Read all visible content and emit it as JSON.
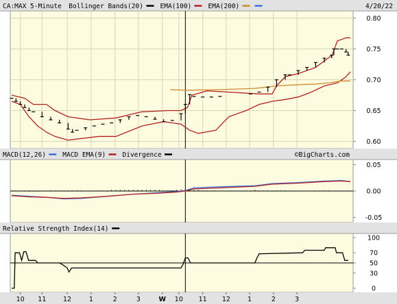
{
  "chart_data": [
    {
      "type": "line",
      "panel": "price",
      "symbol_label": "CA:MAX 5-Minute",
      "date_label": "4/20/22",
      "legend": [
        {
          "label": "Bollinger Bands(20)",
          "color": "#000000"
        },
        {
          "label": "EMA(100)",
          "color": "#b22222"
        },
        {
          "label": "EMA(200)",
          "color": "#d08a2a"
        }
      ],
      "legend_extra_swatch": "#3a6fd8",
      "ylim": [
        0.595,
        0.805
      ],
      "yticks": [
        "0.80",
        "0.75",
        "0.70",
        "0.65",
        "0.60"
      ],
      "grid": true,
      "series": [
        {
          "name": "Bollinger Bands(20)",
          "role": "upper",
          "color": "#b22222",
          "points": [
            [
              0,
              0.675
            ],
            [
              3,
              0.67
            ],
            [
              5,
              0.66
            ],
            [
              8,
              0.66
            ],
            [
              10,
              0.65
            ],
            [
              13,
              0.64
            ],
            [
              18,
              0.635
            ],
            [
              24,
              0.638
            ],
            [
              30,
              0.648
            ],
            [
              36,
              0.65
            ],
            [
              39,
              0.65
            ],
            [
              40.5,
              0.655
            ],
            [
              41.5,
              0.675
            ],
            [
              45,
              0.682
            ],
            [
              50,
              0.68
            ],
            [
              57,
              0.677
            ],
            [
              60,
              0.677
            ],
            [
              61,
              0.69
            ],
            [
              63,
              0.705
            ],
            [
              66,
              0.71
            ],
            [
              70,
              0.72
            ],
            [
              73.8,
              0.74
            ],
            [
              75,
              0.763
            ],
            [
              77,
              0.768
            ],
            [
              78,
              0.768
            ]
          ]
        },
        {
          "name": "Bollinger Bands(20)",
          "role": "lower",
          "color": "#b22222",
          "points": [
            [
              0,
              0.665
            ],
            [
              2,
              0.66
            ],
            [
              4,
              0.64
            ],
            [
              6,
              0.625
            ],
            [
              8,
              0.615
            ],
            [
              10,
              0.608
            ],
            [
              13,
              0.602
            ],
            [
              20,
              0.608
            ],
            [
              24,
              0.608
            ],
            [
              30,
              0.625
            ],
            [
              35,
              0.632
            ],
            [
              39,
              0.628
            ],
            [
              41,
              0.618
            ],
            [
              43,
              0.613
            ],
            [
              47,
              0.618
            ],
            [
              50,
              0.64
            ],
            [
              54,
              0.65
            ],
            [
              57,
              0.66
            ],
            [
              60,
              0.665
            ],
            [
              63,
              0.668
            ],
            [
              66,
              0.672
            ],
            [
              69,
              0.68
            ],
            [
              72,
              0.69
            ],
            [
              75,
              0.695
            ],
            [
              77,
              0.705
            ],
            [
              78,
              0.713
            ]
          ]
        },
        {
          "name": "EMA(200)",
          "color": "#d08a2a",
          "points": [
            [
              36.5,
              0.684
            ],
            [
              40,
              0.683
            ],
            [
              48,
              0.684
            ],
            [
              56,
              0.686
            ],
            [
              61,
              0.69
            ],
            [
              66,
              0.692
            ],
            [
              70,
              0.693
            ],
            [
              73,
              0.695
            ],
            [
              76,
              0.698
            ],
            [
              78,
              0.698
            ]
          ]
        }
      ],
      "ohlc_points": [
        [
          0,
          0.67
        ],
        [
          1,
          0.665
        ],
        [
          2,
          0.66
        ],
        [
          3,
          0.655
        ],
        [
          4,
          0.65
        ],
        [
          5,
          0.648
        ],
        [
          7,
          0.64
        ],
        [
          9,
          0.635
        ],
        [
          11,
          0.63
        ],
        [
          13,
          0.62
        ],
        [
          14,
          0.615
        ],
        [
          15,
          0.618
        ],
        [
          17,
          0.622
        ],
        [
          19,
          0.625
        ],
        [
          21,
          0.628
        ],
        [
          23,
          0.63
        ],
        [
          25,
          0.635
        ],
        [
          27,
          0.64
        ],
        [
          29,
          0.642
        ],
        [
          31,
          0.64
        ],
        [
          33,
          0.636
        ],
        [
          35,
          0.632
        ],
        [
          37,
          0.634
        ],
        [
          39,
          0.645
        ],
        [
          40,
          0.66
        ],
        [
          41,
          0.676
        ],
        [
          42,
          0.673
        ],
        [
          44,
          0.672
        ],
        [
          46,
          0.672
        ],
        [
          48,
          0.673
        ],
        [
          55,
          0.677
        ],
        [
          57,
          0.68
        ],
        [
          59,
          0.688
        ],
        [
          61,
          0.7
        ],
        [
          63,
          0.708
        ],
        [
          64,
          0.708
        ],
        [
          66,
          0.715
        ],
        [
          68,
          0.72
        ],
        [
          70,
          0.728
        ],
        [
          72,
          0.735
        ],
        [
          73.7,
          0.74
        ],
        [
          74.2,
          0.75
        ],
        [
          75,
          0.75
        ],
        [
          76,
          0.75
        ],
        [
          77,
          0.745
        ],
        [
          77.5,
          0.74
        ]
      ]
    },
    {
      "type": "line",
      "panel": "macd",
      "legend": [
        {
          "label": "MACD(12,26)",
          "color": "#3a6fd8"
        },
        {
          "label": "MACD EMA(9)",
          "color": "#b22222"
        },
        {
          "label": "Divergence",
          "color": "#000000"
        }
      ],
      "watermark": "©BigCharts.com",
      "ylim": [
        -0.052,
        0.052
      ],
      "yticks": [
        "0.05",
        "0.00",
        "-0.05"
      ],
      "series": [
        {
          "name": "MACD(12,26)",
          "color": "#3a6fd8",
          "points": [
            [
              0,
              -0.008
            ],
            [
              4,
              -0.01
            ],
            [
              8,
              -0.012
            ],
            [
              12,
              -0.015
            ],
            [
              16,
              -0.014
            ],
            [
              22,
              -0.01
            ],
            [
              28,
              -0.006
            ],
            [
              34,
              -0.003
            ],
            [
              38,
              -0.001
            ],
            [
              40,
              0.001
            ],
            [
              42,
              0.006
            ],
            [
              48,
              0.008
            ],
            [
              56,
              0.01
            ],
            [
              60,
              0.014
            ],
            [
              66,
              0.016
            ],
            [
              72,
              0.019
            ],
            [
              76,
              0.02
            ],
            [
              78,
              0.018
            ]
          ]
        },
        {
          "name": "MACD EMA(9)",
          "color": "#b22222",
          "points": [
            [
              0,
              -0.009
            ],
            [
              4,
              -0.011
            ],
            [
              8,
              -0.012
            ],
            [
              12,
              -0.014
            ],
            [
              16,
              -0.013
            ],
            [
              22,
              -0.01
            ],
            [
              28,
              -0.006
            ],
            [
              34,
              -0.004
            ],
            [
              38,
              -0.002
            ],
            [
              40,
              0
            ],
            [
              42,
              0.004
            ],
            [
              48,
              0.006
            ],
            [
              56,
              0.009
            ],
            [
              60,
              0.013
            ],
            [
              66,
              0.015
            ],
            [
              72,
              0.018
            ],
            [
              76,
              0.019
            ],
            [
              78,
              0.018
            ]
          ]
        }
      ],
      "divergence": [
        0.001,
        0.001,
        0,
        -0.001,
        -0.001,
        -0.001,
        -0.001,
        0,
        0,
        0.001,
        0.001,
        0.001,
        0.001,
        0.001,
        0.001,
        0.001,
        0.001,
        0,
        0,
        0.001,
        0.001,
        0.001,
        0.001,
        0.002,
        0.002,
        0.002,
        0.002,
        0.002,
        0.002,
        0.002,
        0.002,
        0.002,
        0.002,
        0.002,
        0.002,
        0.001,
        0.001,
        0.001,
        0.002,
        0.003,
        0.003,
        0.002,
        0.002,
        0.002,
        0.001,
        0.001,
        0.001,
        0.001,
        0,
        0,
        0,
        0,
        0,
        0,
        0.001,
        0.001,
        0.002,
        0.001,
        0.001,
        0.001,
        0.001,
        0.001,
        0.001,
        0.001,
        0,
        0,
        0,
        0,
        0,
        0,
        0.001,
        0.001,
        0.001,
        0.001,
        0,
        0,
        0,
        0
      ]
    },
    {
      "type": "line",
      "panel": "rsi",
      "legend": [
        {
          "label": "Relative Strength Index(14)",
          "color": "#000000"
        }
      ],
      "ylim": [
        0,
        100
      ],
      "yticks": [
        "100",
        "70",
        "50",
        "30",
        "0"
      ],
      "reference_line": 50,
      "series": [
        {
          "name": "Relative Strength Index(14)",
          "color": "#000000",
          "points": [
            [
              0,
              0
            ],
            [
              0.6,
              0
            ],
            [
              0.8,
              70
            ],
            [
              1.8,
              70
            ],
            [
              2.3,
              55
            ],
            [
              2.8,
              72
            ],
            [
              3.3,
              72
            ],
            [
              3.9,
              55
            ],
            [
              5.5,
              55
            ],
            [
              6,
              50
            ],
            [
              11,
              50
            ],
            [
              12,
              45
            ],
            [
              12.8,
              40
            ],
            [
              13.2,
              32
            ],
            [
              13.8,
              40
            ],
            [
              14.8,
              40
            ],
            [
              28,
              40
            ],
            [
              38,
              40
            ],
            [
              39,
              40
            ],
            [
              39.5,
              48
            ],
            [
              40,
              60
            ],
            [
              40.6,
              60
            ],
            [
              41.2,
              50
            ],
            [
              56,
              50
            ],
            [
              56.5,
              60
            ],
            [
              57,
              68
            ],
            [
              67,
              70
            ],
            [
              67.5,
              75
            ],
            [
              72,
              75
            ],
            [
              72.3,
              80
            ],
            [
              74.5,
              80
            ],
            [
              74.8,
              70
            ],
            [
              76.2,
              70
            ],
            [
              76.7,
              55
            ],
            [
              77.5,
              55
            ]
          ]
        }
      ]
    }
  ],
  "x_axis": {
    "ticks": [
      {
        "label": "10",
        "x": 2
      },
      {
        "label": "11",
        "x": 7
      },
      {
        "label": "12",
        "x": 12.8
      },
      {
        "label": "1",
        "x": 18.3
      },
      {
        "label": "2",
        "x": 23.8
      },
      {
        "label": "3",
        "x": 29.2
      },
      {
        "label": "W",
        "x": 34.7,
        "bold": true
      },
      {
        "label": "10",
        "x": 38.5
      },
      {
        "label": "11",
        "x": 44
      },
      {
        "label": "12",
        "x": 49.4
      },
      {
        "label": "1",
        "x": 54.8
      },
      {
        "label": "2",
        "x": 60.3
      },
      {
        "label": "3",
        "x": 65.7
      }
    ],
    "day_separator_x": 40
  }
}
